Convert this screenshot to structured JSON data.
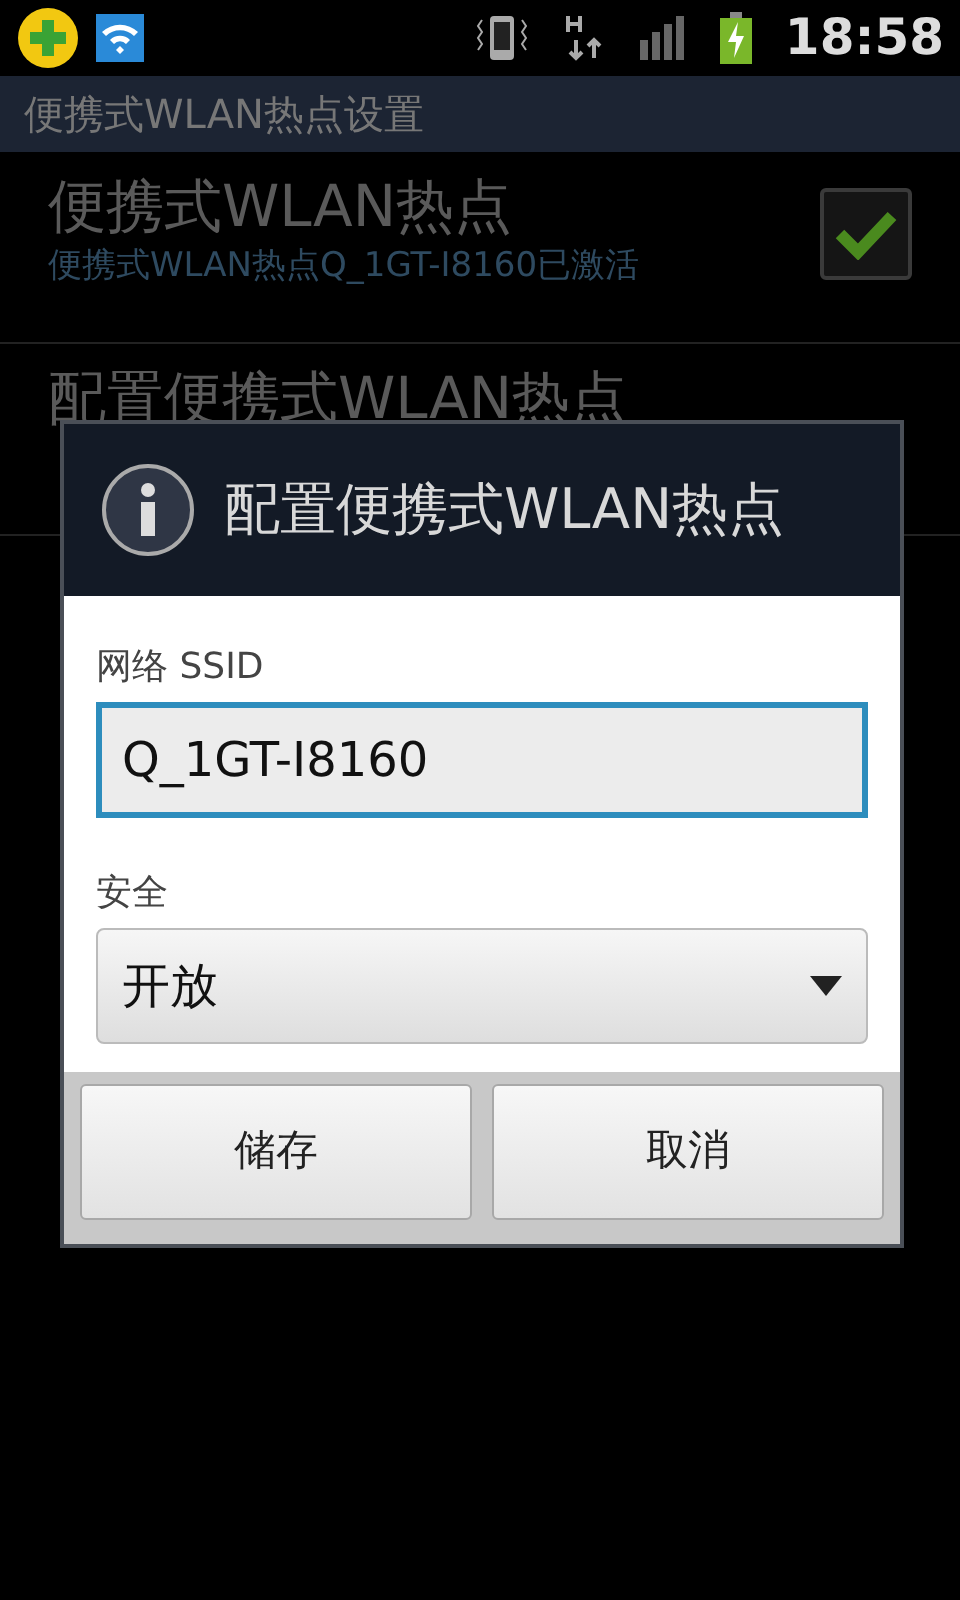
{
  "status_bar": {
    "time": "18:58"
  },
  "title_bar": {
    "title": "便携式WLAN热点设置"
  },
  "settings": [
    {
      "kind": "checkbox",
      "title": "便携式WLAN热点",
      "summary": "便携式WLAN热点Q_1GT-I8160已激活",
      "checked": true
    },
    {
      "kind": "plain",
      "title": "配置便携式WLAN热点"
    }
  ],
  "dialog": {
    "title": "配置便携式WLAN热点",
    "ssid_label": "网络 SSID",
    "ssid_value": "Q_1GT-I8160",
    "security_label": "安全",
    "security_value": "开放",
    "buttons": [
      "储存",
      "取消"
    ]
  }
}
